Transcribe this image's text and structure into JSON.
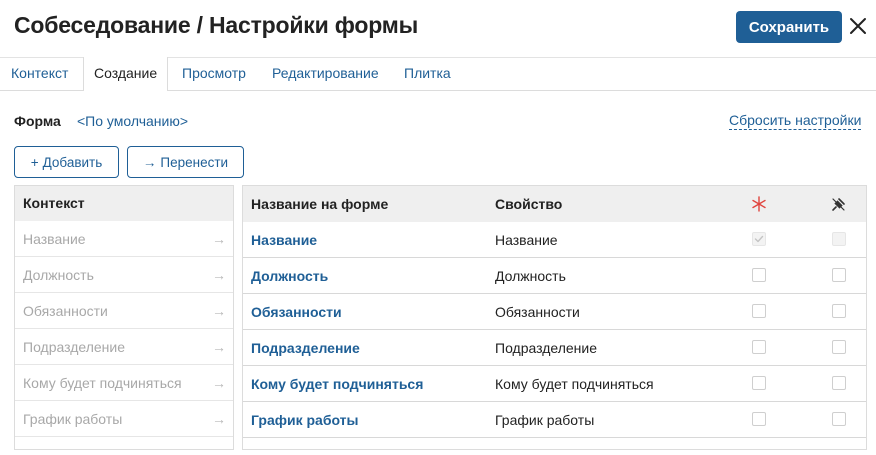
{
  "header": {
    "title": "Собеседование / Настройки формы",
    "save_label": "Сохранить"
  },
  "tabs": [
    {
      "label": "Контекст",
      "active": false
    },
    {
      "label": "Создание",
      "active": true
    },
    {
      "label": "Просмотр",
      "active": false
    },
    {
      "label": "Редактирование",
      "active": false
    },
    {
      "label": "Плитка",
      "active": false
    }
  ],
  "form": {
    "label": "Форма",
    "value": "<По умолчанию>",
    "reset_label": "Сбросить настройки"
  },
  "toolbar": {
    "add_icon": "+",
    "add_label": "Добавить",
    "move_icon": "→",
    "move_label": "Перенести"
  },
  "context_panel": {
    "header": "Контекст",
    "arrow_glyph": "→",
    "items": [
      "Название",
      "Должность",
      "Обязанности",
      "Подразделение",
      "Кому будет подчиняться",
      "График работы"
    ]
  },
  "fields_table": {
    "col_name": "Название на форме",
    "col_property": "Свойство",
    "required_icon": "asterisk-icon",
    "readonly_icon": "pin-off-icon",
    "rows": [
      {
        "name": "Название",
        "property": "Название",
        "required": true,
        "required_disabled": true,
        "readonly": false,
        "readonly_disabled": true
      },
      {
        "name": "Должность",
        "property": "Должность",
        "required": false,
        "required_disabled": false,
        "readonly": false,
        "readonly_disabled": false
      },
      {
        "name": "Обязанности",
        "property": "Обязанности",
        "required": false,
        "required_disabled": false,
        "readonly": false,
        "readonly_disabled": false
      },
      {
        "name": "Подразделение",
        "property": "Подразделение",
        "required": false,
        "required_disabled": false,
        "readonly": false,
        "readonly_disabled": false
      },
      {
        "name": "Кому будет подчиняться",
        "property": "Кому будет подчиняться",
        "required": false,
        "required_disabled": false,
        "readonly": false,
        "readonly_disabled": false
      },
      {
        "name": "График работы",
        "property": "График работы",
        "required": false,
        "required_disabled": false,
        "readonly": false,
        "readonly_disabled": false
      }
    ]
  },
  "colors": {
    "accent": "#1f5f96",
    "required_star": "#e0443e"
  }
}
